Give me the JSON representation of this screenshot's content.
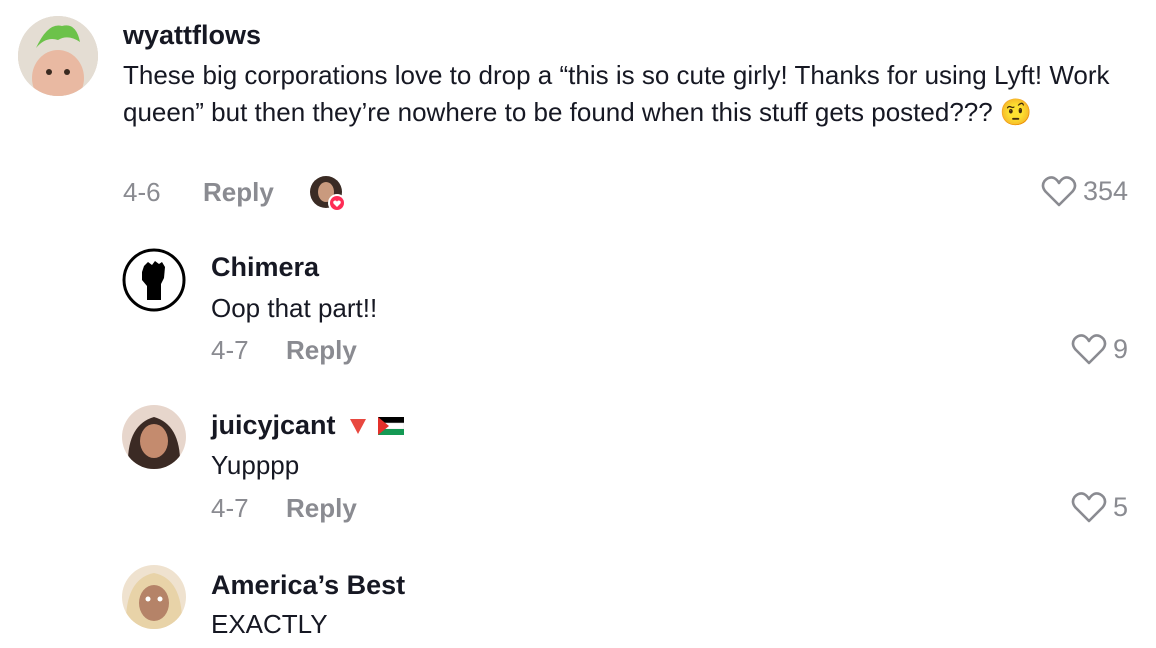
{
  "comments": [
    {
      "username": "wyattflows",
      "text": "These big corporations love to drop a “this is so cute girly! Thanks for using Lyft! Work queen” but then they’re nowhere to be found when this stuff gets posted??? 🤨",
      "date": "4-6",
      "reply_label": "Reply",
      "likes": "354",
      "creator_liked": true
    },
    {
      "username": "Chimera",
      "text": "Oop that part!!",
      "date": "4-7",
      "reply_label": "Reply",
      "likes": "9"
    },
    {
      "username": "juicyjcant",
      "username_badges": [
        "red-triangle-icon",
        "palestine-flag-icon"
      ],
      "text": "Yupppp",
      "date": "4-7",
      "reply_label": "Reply",
      "likes": "5"
    },
    {
      "username": "America’s Best",
      "text": "EXACTLY"
    }
  ],
  "colors": {
    "text": "#161823",
    "muted": "#8a8b91",
    "like_badge": "#fe2c55"
  }
}
